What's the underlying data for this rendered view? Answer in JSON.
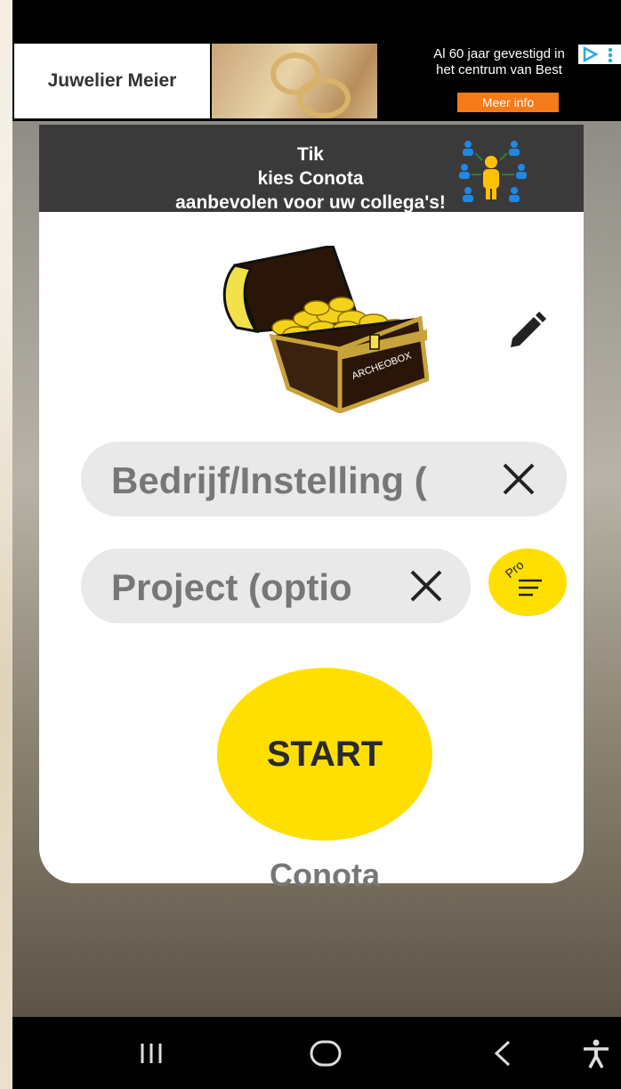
{
  "ad": {
    "advertiser": "Juwelier Meier",
    "headline_line1": "Al 60 jaar gevestigd in",
    "headline_line2": "het centrum van Best",
    "cta": "Meer info",
    "badge_icon": "adchoices-icon"
  },
  "promo": {
    "line1": "Tik",
    "line2": "kies Conota",
    "line3": "aanbevolen voor uw collega's!",
    "icon": "share-people-icon"
  },
  "logo": {
    "chest_label": "ARCHEOBOX",
    "icon": "treasure-chest-logo"
  },
  "edit": {
    "icon": "pencil-icon"
  },
  "fields": {
    "company_placeholder": "Bedrijf/Instelling (",
    "project_placeholder": "Project (optio",
    "clear_icon": "close-icon"
  },
  "pro_button": {
    "label": "Pro",
    "icon": "filter-list-icon"
  },
  "start_button": {
    "label": "START"
  },
  "app_name": "Conota",
  "navbar": {
    "recent_icon": "recent-apps-icon",
    "home_icon": "home-icon",
    "back_icon": "back-icon",
    "accessibility_icon": "accessibility-icon"
  },
  "colors": {
    "accent_yellow": "#ffdf00",
    "field_bg": "#e9e9e9",
    "promo_bg": "#3a3a3a",
    "ad_cta": "#f47a1a"
  }
}
